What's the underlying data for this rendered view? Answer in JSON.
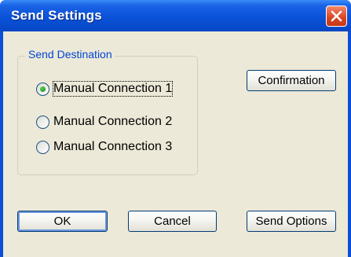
{
  "window": {
    "title": "Send Settings"
  },
  "group": {
    "label": "Send Destination",
    "options": [
      {
        "label": "Manual Connection 1",
        "selected": true
      },
      {
        "label": "Manual Connection 2",
        "selected": false
      },
      {
        "label": "Manual Connection 3",
        "selected": false
      }
    ]
  },
  "buttons": {
    "confirmation": "Confirmation",
    "ok": "OK",
    "cancel": "Cancel",
    "send_options": "Send Options"
  },
  "colors": {
    "titlebar": "#0a52d8",
    "close": "#d9441f",
    "group_label": "#0046d5",
    "radio_dot": "#1e8c1e"
  },
  "icons": {
    "close": "close-icon"
  }
}
